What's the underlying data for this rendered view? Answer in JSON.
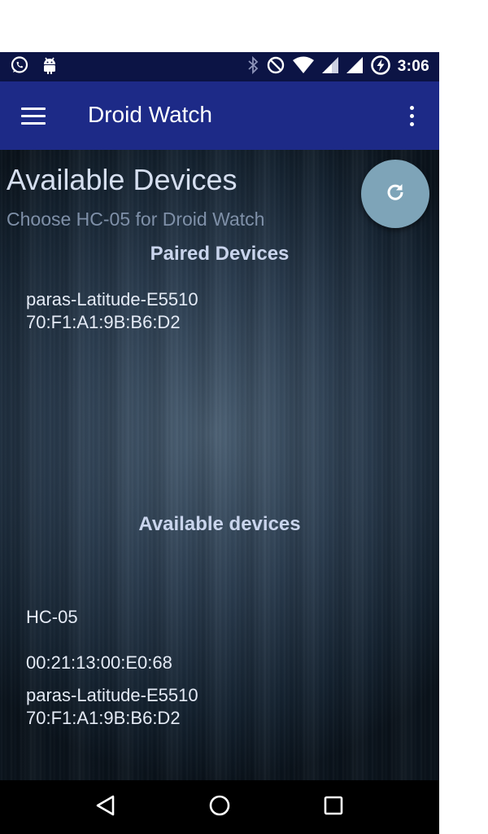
{
  "status_bar": {
    "time": "3:06",
    "left_icons": [
      "whatsapp-icon",
      "android-icon"
    ],
    "right_icons": [
      "bluetooth-icon",
      "do-not-disturb-icon",
      "wifi-icon",
      "signal-icon",
      "signal-icon",
      "battery-charging-icon"
    ]
  },
  "toolbar": {
    "title": "Droid Watch"
  },
  "main": {
    "heading": "Available Devices",
    "subheading": "Choose HC-05 for Droid Watch",
    "paired_title": "Paired Devices",
    "paired_devices": [
      {
        "name": "paras-Latitude-E5510",
        "address": "70:F1:A1:9B:B6:D2"
      }
    ],
    "available_title": "Available devices",
    "available_devices": [
      {
        "name": "HC-05"
      },
      {
        "name": "00:21:13:00:E0:68"
      },
      {
        "name": "paras-Latitude-E5510",
        "address": "70:F1:A1:9B:B6:D2"
      }
    ]
  },
  "colors": {
    "status_bar": "#0c1445",
    "toolbar": "#1d2a87",
    "fab": "#7ea4b8",
    "nav_bar": "#000000"
  }
}
